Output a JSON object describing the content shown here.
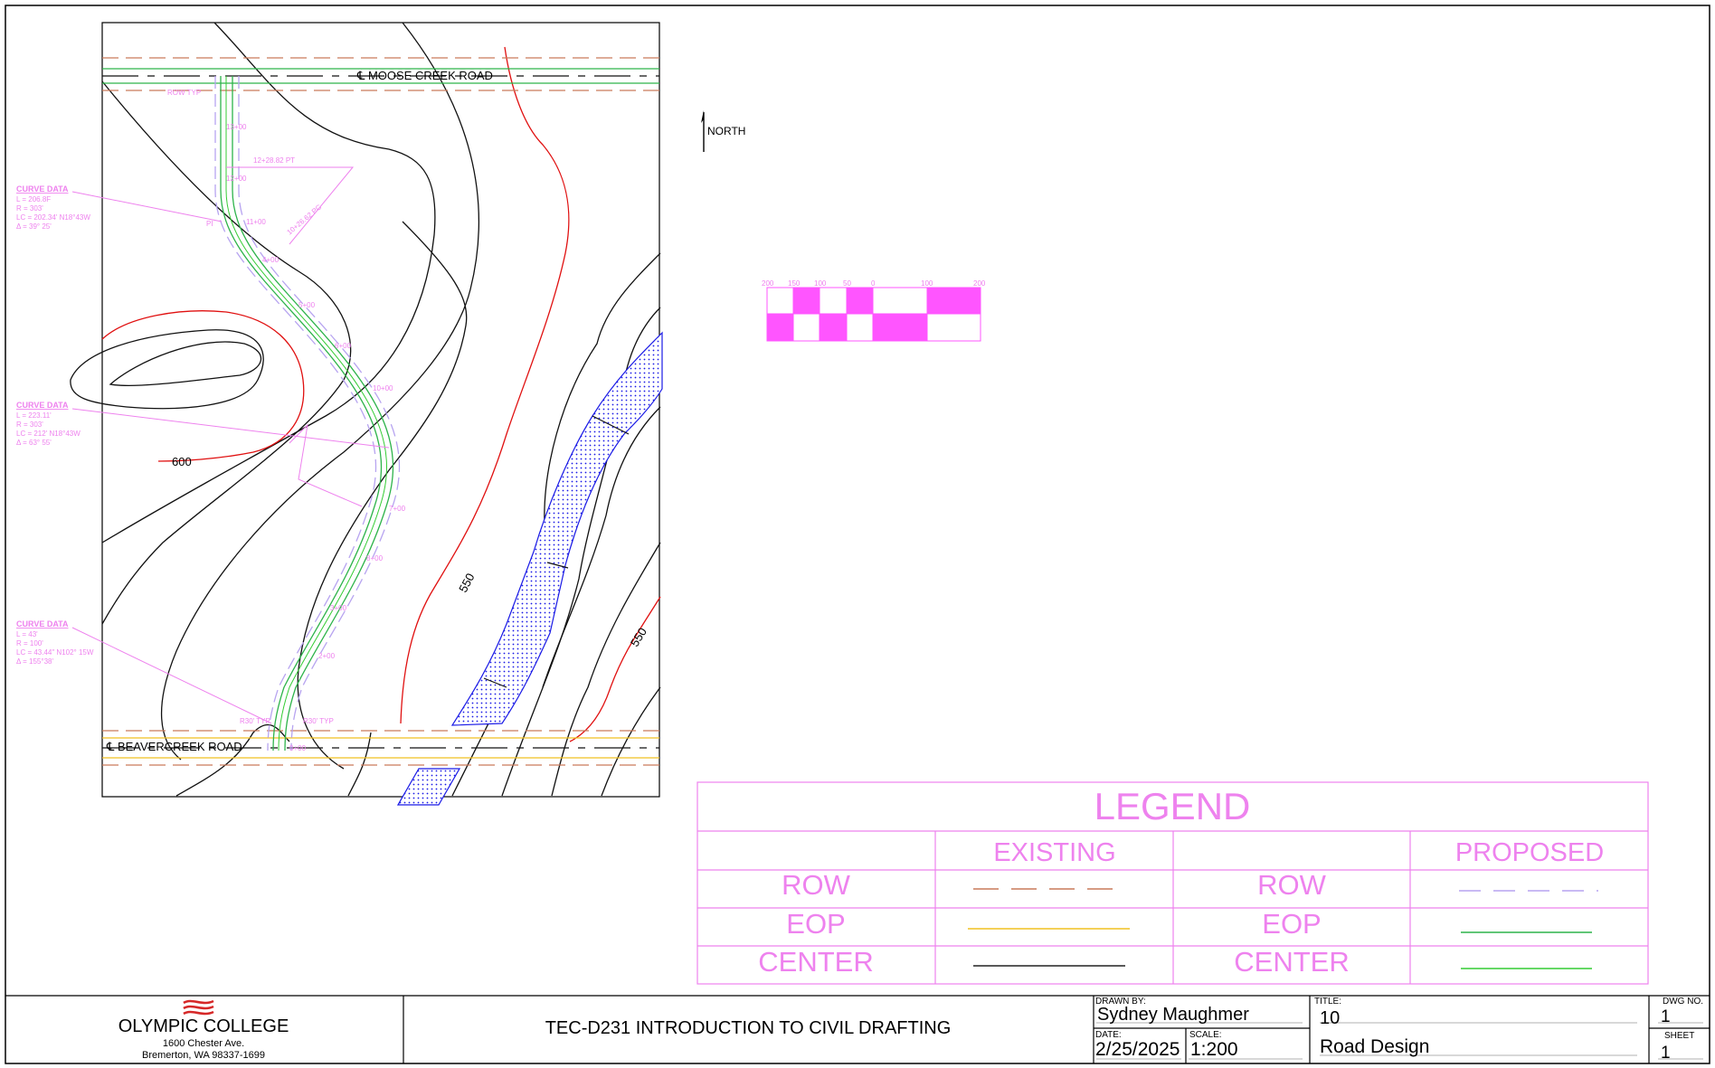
{
  "drawing": {
    "roads": {
      "top": "℄ MOOSE CREEK ROAD",
      "bottom": "℄ BEAVERCREEK ROAD"
    },
    "north_label": "NORTH",
    "contours": [
      "600",
      "550",
      "550"
    ],
    "curve_data": [
      {
        "title": "CURVE DATA",
        "lines": [
          "L = 206.8F",
          "R = 303'",
          "LC = 202.34' N18°43W",
          "Δ = 39° 25'"
        ]
      },
      {
        "title": "CURVE DATA",
        "lines": [
          "L = 223.11'",
          "R = 303'",
          "LC = 212' N18°43W",
          "Δ = 63° 55'"
        ]
      },
      {
        "title": "CURVE DATA",
        "lines": [
          "L = 43'",
          "R = 100'",
          "LC = 43.44\" N102° 15W",
          "Δ = 155°38'"
        ]
      }
    ],
    "station_labels": [
      "13+00",
      "12+00",
      "12+28.82 PT",
      "10+26.62 PC",
      "11+00",
      "PI",
      "ROW TYP",
      "R30' TYP",
      "R30' TYP",
      "2+00",
      "3+00",
      "8+00",
      "7+00",
      "10+00",
      "6+00",
      "5+00",
      "4+00",
      "0+00"
    ]
  },
  "scale_bar": {
    "labels": [
      "200",
      "150",
      "100",
      "50",
      "0",
      "100",
      "200"
    ],
    "fill_color": "#ff55ff"
  },
  "legend": {
    "title": "LEGEND",
    "existing_header": "EXISTING",
    "proposed_header": "PROPOSED",
    "rows": [
      {
        "label": "ROW",
        "existing_color": "#c97a5a",
        "proposed_color": "#b7a4f0",
        "label2": "ROW"
      },
      {
        "label": "EOP",
        "existing_color": "#f0c020",
        "proposed_color": "#2db34a",
        "label2": "EOP"
      },
      {
        "label": "CENTER",
        "existing_color": "#222222",
        "proposed_color": "#33cc33",
        "label2": "CENTER"
      }
    ],
    "color": "#ee82ee"
  },
  "title_block": {
    "college": "OLYMPIC COLLEGE",
    "address1": "1600 Chester Ave.",
    "address2": "Bremerton, WA 98337-1699",
    "course": "TEC-D231 INTRODUCTION TO CIVIL DRAFTING",
    "drawn_by_label": "DRAWN  BY:",
    "drawn_by": "Sydney Maughmer",
    "date_label": "DATE:",
    "date": "2/25/2025",
    "scale_label": "SCALE:",
    "scale": "1:200",
    "title_label": "TITLE:",
    "title_num": "10",
    "title": "Road Design",
    "dwg_label": "DWG NO.",
    "dwg": "1",
    "sheet_label": "SHEET",
    "sheet": "1"
  }
}
